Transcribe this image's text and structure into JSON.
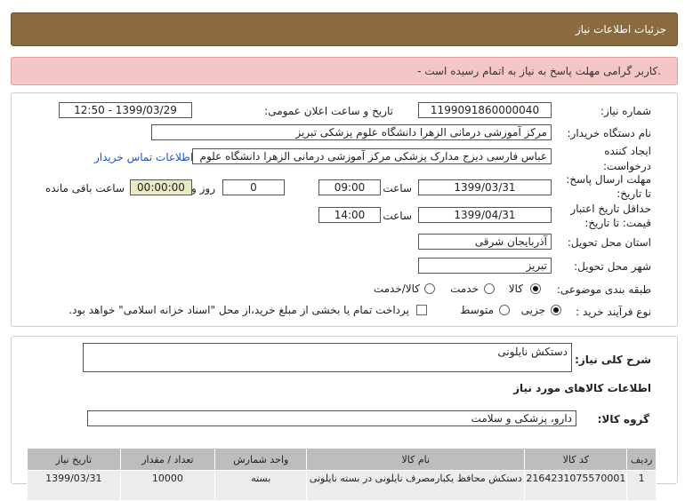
{
  "header": {
    "title": "جزئیات اطلاعات نیاز"
  },
  "alert": {
    "message": "- کاربر گرامی مهلت پاسخ به نیاز به اتمام رسیده است."
  },
  "form": {
    "need_number_label": "شماره نیاز:",
    "need_number": "1199091860000040",
    "announce_label": "تاریخ و ساعت اعلان عمومی:",
    "announce_value": "1399/03/29 - 12:50",
    "buyer_label": "نام دستگاه خریدار:",
    "buyer_value": "مرکز آموزشی درمانی الزهرا دانشگاه علوم پزشکی تبریز",
    "creator_label_1": "ایجاد کننده",
    "creator_label_2": "درخواست:",
    "creator_value": "عباس  فارسی دیزج  مدارک پزشکی  مرکز آموزشی درمانی الزهرا دانشگاه علوم",
    "contact_link": "اطلاعات تماس خریدار",
    "deadline_label_1": "مهلت ارسال پاسخ:",
    "deadline_label_2": "تا تاریخ:",
    "deadline_date": "1399/03/31",
    "time_label": "ساعت",
    "deadline_time": "09:00",
    "days_value": "0",
    "days_label": "روز و",
    "remaining_value": "00:00:00",
    "remaining_label": "ساعت باقی مانده",
    "validity_label_1": "حداقل تاریخ اعتبار",
    "validity_label_2": "قیمت: تا تاریخ:",
    "validity_date": "1399/04/31",
    "validity_time": "14:00",
    "province_label": "استان محل تحویل:",
    "province_value": "آذربایجان شرقی",
    "city_label": "شهر محل تحویل:",
    "city_value": "تبریز",
    "category_label": "طبقه بندی موضوعی:",
    "category_options": [
      "کالا",
      "خدمت",
      "کالا/خدمت"
    ],
    "process_label": "نوع فرآیند خرید :",
    "process_options": [
      "جزیی",
      "متوسط"
    ],
    "payment_note": "پرداخت تمام یا بخشی از مبلغ خرید،از محل \"اسناد خزانه اسلامی\" خواهد بود."
  },
  "description": {
    "summary_label": "شرح کلی نیاز:",
    "summary_value": "دستکش نایلونی",
    "goods_info_title": "اطلاعات کالاهای مورد نیاز",
    "group_label": "گروه کالا:",
    "group_value": "دارو، پزشکی و سلامت"
  },
  "table": {
    "headers": [
      "ردیف",
      "کد کالا",
      "نام کالا",
      "واحد شمارش",
      "تعداد / مقدار",
      "تاریخ نیاز"
    ],
    "rows": [
      [
        "1",
        "2164231075570001",
        "دستکش محافظ یکبارمصرف نایلونی در بسته نایلونی",
        "بسته",
        "10000",
        "1399/03/31"
      ]
    ]
  }
}
